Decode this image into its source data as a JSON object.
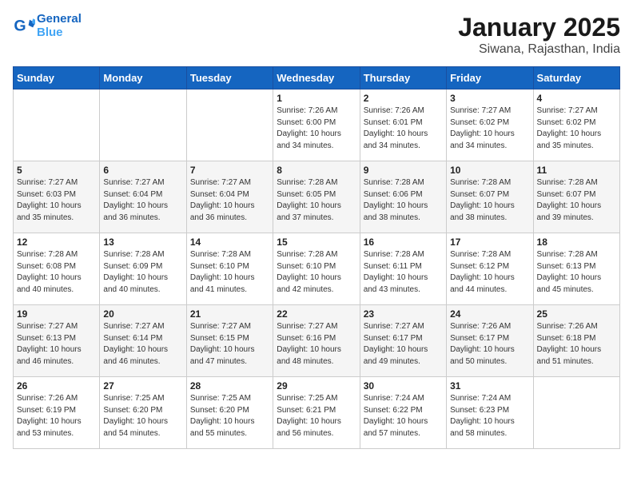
{
  "header": {
    "logo_line1": "General",
    "logo_line2": "Blue",
    "title": "January 2025",
    "subtitle": "Siwana, Rajasthan, India"
  },
  "weekdays": [
    "Sunday",
    "Monday",
    "Tuesday",
    "Wednesday",
    "Thursday",
    "Friday",
    "Saturday"
  ],
  "weeks": [
    [
      {
        "day": "",
        "info": ""
      },
      {
        "day": "",
        "info": ""
      },
      {
        "day": "",
        "info": ""
      },
      {
        "day": "1",
        "info": "Sunrise: 7:26 AM\nSunset: 6:00 PM\nDaylight: 10 hours\nand 34 minutes."
      },
      {
        "day": "2",
        "info": "Sunrise: 7:26 AM\nSunset: 6:01 PM\nDaylight: 10 hours\nand 34 minutes."
      },
      {
        "day": "3",
        "info": "Sunrise: 7:27 AM\nSunset: 6:02 PM\nDaylight: 10 hours\nand 34 minutes."
      },
      {
        "day": "4",
        "info": "Sunrise: 7:27 AM\nSunset: 6:02 PM\nDaylight: 10 hours\nand 35 minutes."
      }
    ],
    [
      {
        "day": "5",
        "info": "Sunrise: 7:27 AM\nSunset: 6:03 PM\nDaylight: 10 hours\nand 35 minutes."
      },
      {
        "day": "6",
        "info": "Sunrise: 7:27 AM\nSunset: 6:04 PM\nDaylight: 10 hours\nand 36 minutes."
      },
      {
        "day": "7",
        "info": "Sunrise: 7:27 AM\nSunset: 6:04 PM\nDaylight: 10 hours\nand 36 minutes."
      },
      {
        "day": "8",
        "info": "Sunrise: 7:28 AM\nSunset: 6:05 PM\nDaylight: 10 hours\nand 37 minutes."
      },
      {
        "day": "9",
        "info": "Sunrise: 7:28 AM\nSunset: 6:06 PM\nDaylight: 10 hours\nand 38 minutes."
      },
      {
        "day": "10",
        "info": "Sunrise: 7:28 AM\nSunset: 6:07 PM\nDaylight: 10 hours\nand 38 minutes."
      },
      {
        "day": "11",
        "info": "Sunrise: 7:28 AM\nSunset: 6:07 PM\nDaylight: 10 hours\nand 39 minutes."
      }
    ],
    [
      {
        "day": "12",
        "info": "Sunrise: 7:28 AM\nSunset: 6:08 PM\nDaylight: 10 hours\nand 40 minutes."
      },
      {
        "day": "13",
        "info": "Sunrise: 7:28 AM\nSunset: 6:09 PM\nDaylight: 10 hours\nand 40 minutes."
      },
      {
        "day": "14",
        "info": "Sunrise: 7:28 AM\nSunset: 6:10 PM\nDaylight: 10 hours\nand 41 minutes."
      },
      {
        "day": "15",
        "info": "Sunrise: 7:28 AM\nSunset: 6:10 PM\nDaylight: 10 hours\nand 42 minutes."
      },
      {
        "day": "16",
        "info": "Sunrise: 7:28 AM\nSunset: 6:11 PM\nDaylight: 10 hours\nand 43 minutes."
      },
      {
        "day": "17",
        "info": "Sunrise: 7:28 AM\nSunset: 6:12 PM\nDaylight: 10 hours\nand 44 minutes."
      },
      {
        "day": "18",
        "info": "Sunrise: 7:28 AM\nSunset: 6:13 PM\nDaylight: 10 hours\nand 45 minutes."
      }
    ],
    [
      {
        "day": "19",
        "info": "Sunrise: 7:27 AM\nSunset: 6:13 PM\nDaylight: 10 hours\nand 46 minutes."
      },
      {
        "day": "20",
        "info": "Sunrise: 7:27 AM\nSunset: 6:14 PM\nDaylight: 10 hours\nand 46 minutes."
      },
      {
        "day": "21",
        "info": "Sunrise: 7:27 AM\nSunset: 6:15 PM\nDaylight: 10 hours\nand 47 minutes."
      },
      {
        "day": "22",
        "info": "Sunrise: 7:27 AM\nSunset: 6:16 PM\nDaylight: 10 hours\nand 48 minutes."
      },
      {
        "day": "23",
        "info": "Sunrise: 7:27 AM\nSunset: 6:17 PM\nDaylight: 10 hours\nand 49 minutes."
      },
      {
        "day": "24",
        "info": "Sunrise: 7:26 AM\nSunset: 6:17 PM\nDaylight: 10 hours\nand 50 minutes."
      },
      {
        "day": "25",
        "info": "Sunrise: 7:26 AM\nSunset: 6:18 PM\nDaylight: 10 hours\nand 51 minutes."
      }
    ],
    [
      {
        "day": "26",
        "info": "Sunrise: 7:26 AM\nSunset: 6:19 PM\nDaylight: 10 hours\nand 53 minutes."
      },
      {
        "day": "27",
        "info": "Sunrise: 7:25 AM\nSunset: 6:20 PM\nDaylight: 10 hours\nand 54 minutes."
      },
      {
        "day": "28",
        "info": "Sunrise: 7:25 AM\nSunset: 6:20 PM\nDaylight: 10 hours\nand 55 minutes."
      },
      {
        "day": "29",
        "info": "Sunrise: 7:25 AM\nSunset: 6:21 PM\nDaylight: 10 hours\nand 56 minutes."
      },
      {
        "day": "30",
        "info": "Sunrise: 7:24 AM\nSunset: 6:22 PM\nDaylight: 10 hours\nand 57 minutes."
      },
      {
        "day": "31",
        "info": "Sunrise: 7:24 AM\nSunset: 6:23 PM\nDaylight: 10 hours\nand 58 minutes."
      },
      {
        "day": "",
        "info": ""
      }
    ]
  ]
}
